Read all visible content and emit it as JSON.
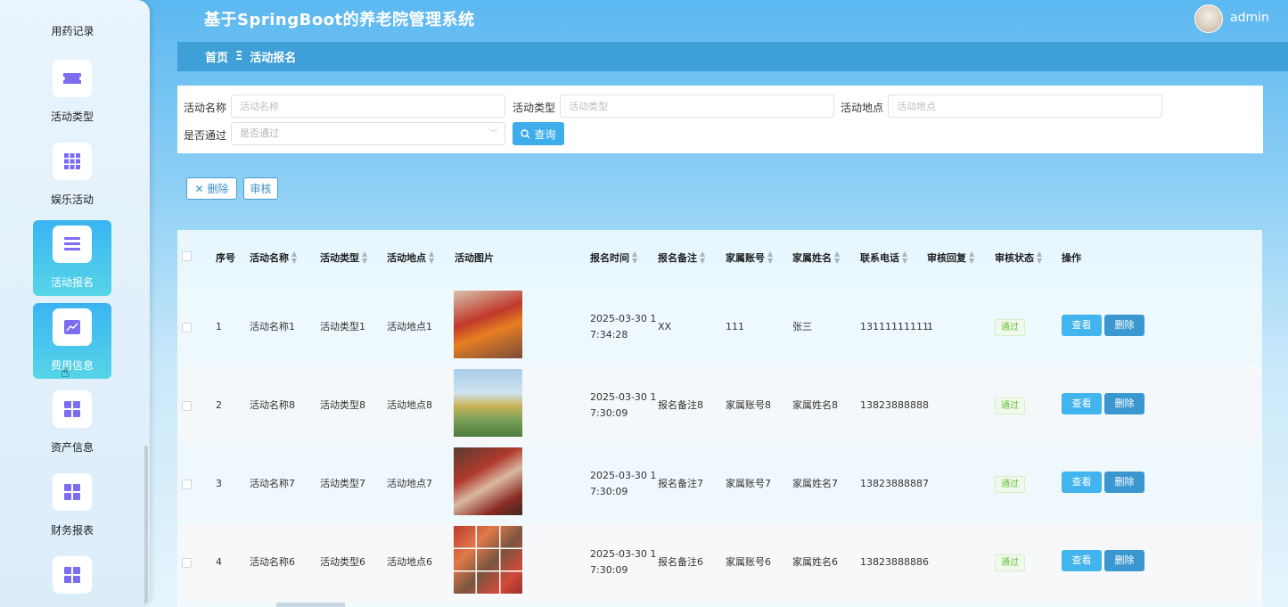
{
  "app": {
    "title": "基于SpringBoot的养老院管理系统",
    "user": "admin"
  },
  "sidebar": {
    "partial_top": "用药记录",
    "items": [
      {
        "label": "活动类型",
        "icon": "ticket-icon",
        "active": false
      },
      {
        "label": "娱乐活动",
        "icon": "grid-icon",
        "active": false
      },
      {
        "label": "活动报名",
        "icon": "list-icon",
        "active": true
      },
      {
        "label": "费用信息",
        "icon": "chart-icon",
        "active": true
      },
      {
        "label": "资产信息",
        "icon": "apps-icon",
        "active": false
      },
      {
        "label": "财务报表",
        "icon": "apps-icon",
        "active": false
      },
      {
        "label": "",
        "icon": "apps-icon",
        "active": false
      }
    ]
  },
  "breadcrumb": {
    "home": "首页",
    "separator": "Ξ",
    "current": "活动报名"
  },
  "search": {
    "name_label": "活动名称",
    "name_placeholder": "活动名称",
    "type_label": "活动类型",
    "type_placeholder": "活动类型",
    "place_label": "活动地点",
    "place_placeholder": "活动地点",
    "pass_label": "是否通过",
    "pass_placeholder": "是否通过",
    "query_btn": "查询"
  },
  "actions": {
    "delete": "删除",
    "audit": "审核"
  },
  "table": {
    "headers": [
      "序号",
      "活动名称",
      "活动类型",
      "活动地点",
      "活动图片",
      "报名时间",
      "报名备注",
      "家属账号",
      "家属姓名",
      "联系电话",
      "审核回复",
      "审核状态",
      "操作"
    ],
    "rows": [
      {
        "no": "1",
        "name": "活动名称1",
        "type": "活动类型1",
        "place": "活动地点1",
        "time1": "2025-03-30 1",
        "time2": "7:34:28",
        "remark": "XX",
        "account": "111",
        "family": "张三",
        "phone": "13111111111",
        "reply": "1",
        "status": "通过"
      },
      {
        "no": "2",
        "name": "活动名称8",
        "type": "活动类型8",
        "place": "活动地点8",
        "time1": "2025-03-30 1",
        "time2": "7:30:09",
        "remark": "报名备注8",
        "account": "家属账号8",
        "family": "家属姓名8",
        "phone": "13823888888",
        "reply": "",
        "status": "通过"
      },
      {
        "no": "3",
        "name": "活动名称7",
        "type": "活动类型7",
        "place": "活动地点7",
        "time1": "2025-03-30 1",
        "time2": "7:30:09",
        "remark": "报名备注7",
        "account": "家属账号7",
        "family": "家属姓名7",
        "phone": "13823888887",
        "reply": "",
        "status": "通过"
      },
      {
        "no": "4",
        "name": "活动名称6",
        "type": "活动类型6",
        "place": "活动地点6",
        "time1": "2025-03-30 1",
        "time2": "7:30:09",
        "remark": "报名备注6",
        "account": "家属账号6",
        "family": "家属姓名6",
        "phone": "13823888886",
        "reply": "",
        "status": "通过"
      }
    ],
    "view_btn": "查看",
    "delete_btn": "删除"
  }
}
